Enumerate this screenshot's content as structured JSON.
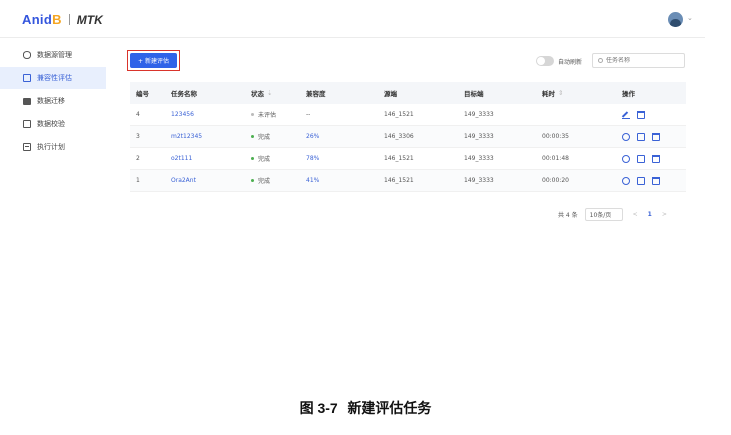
{
  "header": {
    "logo_main": "Anid",
    "logo_accent": "B",
    "product": "MTK"
  },
  "sidebar": {
    "items": [
      {
        "label": "数据源管理",
        "icon": "database-icon",
        "active": false
      },
      {
        "label": "兼容性评估",
        "icon": "document-icon",
        "active": true
      },
      {
        "label": "数据迁移",
        "icon": "folder-icon",
        "active": false
      },
      {
        "label": "数据校验",
        "icon": "check-icon",
        "active": false
      },
      {
        "label": "执行计划",
        "icon": "calendar-icon",
        "active": false
      }
    ]
  },
  "toolbar": {
    "new_button": "+ 新建评估",
    "auto_refresh_label": "自动刷新",
    "search_placeholder": "任务名称"
  },
  "table": {
    "columns": [
      "编号",
      "任务名称",
      "状态",
      "兼容度",
      "源端",
      "目标端",
      "耗时",
      "操作"
    ],
    "rows": [
      {
        "id": "4",
        "name": "123456",
        "status": "未评估",
        "status_color": "grey",
        "compat": "--",
        "source": "146_1521",
        "target": "149_3333",
        "duration": "",
        "ops": [
          "edit-icon",
          "delete-icon"
        ]
      },
      {
        "id": "3",
        "name": "m2t12345",
        "status": "完成",
        "status_color": "green",
        "compat": "26%",
        "source": "146_3306",
        "target": "149_3333",
        "duration": "00:00:35",
        "ops": [
          "replay-icon",
          "report-icon",
          "delete-icon"
        ]
      },
      {
        "id": "2",
        "name": "o2t111",
        "status": "完成",
        "status_color": "green",
        "compat": "78%",
        "source": "146_1521",
        "target": "149_3333",
        "duration": "00:01:48",
        "ops": [
          "replay-icon",
          "report-icon",
          "delete-icon"
        ]
      },
      {
        "id": "1",
        "name": "Ora2Ant",
        "status": "完成",
        "status_color": "green",
        "compat": "41%",
        "source": "146_1521",
        "target": "149_3333",
        "duration": "00:00:20",
        "ops": [
          "replay-icon",
          "report-icon",
          "delete-icon"
        ]
      }
    ]
  },
  "pagination": {
    "total": "共 4 条",
    "page_size": "10条/页",
    "current": "1",
    "prev": "<",
    "next": ">"
  },
  "caption": {
    "number": "图 3-7",
    "title": "新建评估任务"
  },
  "colors": {
    "primary": "#2f63e8",
    "highlight_frame": "#d9342b",
    "success": "#4caf50"
  }
}
